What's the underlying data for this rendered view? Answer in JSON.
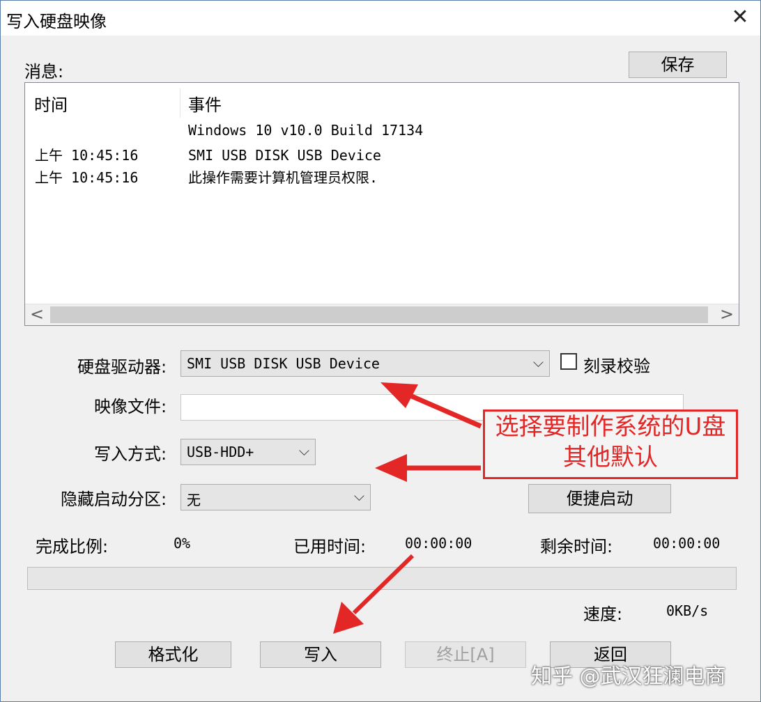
{
  "window": {
    "title": "写入硬盘映像",
    "close_glyph": "✕"
  },
  "messages": {
    "label": "消息:",
    "save_button": "保存",
    "columns": {
      "time": "时间",
      "event": "事件"
    },
    "rows": [
      {
        "time": "",
        "event": "Windows 10 v10.0 Build 17134"
      },
      {
        "time": "上午 10:45:16",
        "event": "SMI USB DISK USB Device"
      },
      {
        "time": "上午 10:45:16",
        "event": "此操作需要计算机管理员权限."
      }
    ],
    "scroll_left": "<",
    "scroll_right": ">"
  },
  "form": {
    "drive_label": "硬盘驱动器:",
    "drive_value": "SMI USB DISK USB Device",
    "verify_label": "刻录校验",
    "verify_checked": false,
    "image_label": "映像文件:",
    "image_value": "",
    "write_mode_label": "写入方式:",
    "write_mode_value": "USB-HDD+",
    "hidden_partition_label": "隐藏启动分区:",
    "hidden_partition_value": "无",
    "quick_boot_button": "便捷启动"
  },
  "status": {
    "complete_label": "完成比例:",
    "complete_value": "0%",
    "progress_fraction": 0,
    "elapsed_label": "已用时间:",
    "elapsed_value": "00:00:00",
    "remaining_label": "剩余时间:",
    "remaining_value": "00:00:00",
    "speed_label": "速度:",
    "speed_value": "0KB/s"
  },
  "buttons": {
    "format": "格式化",
    "write": "写入",
    "abort": "终止[A]",
    "back": "返回"
  },
  "annotation": {
    "line1": "选择要制作系统的U盘",
    "line2": "其他默认",
    "color": "#e32626"
  },
  "watermark": "知乎 @武汉狂澜电商"
}
